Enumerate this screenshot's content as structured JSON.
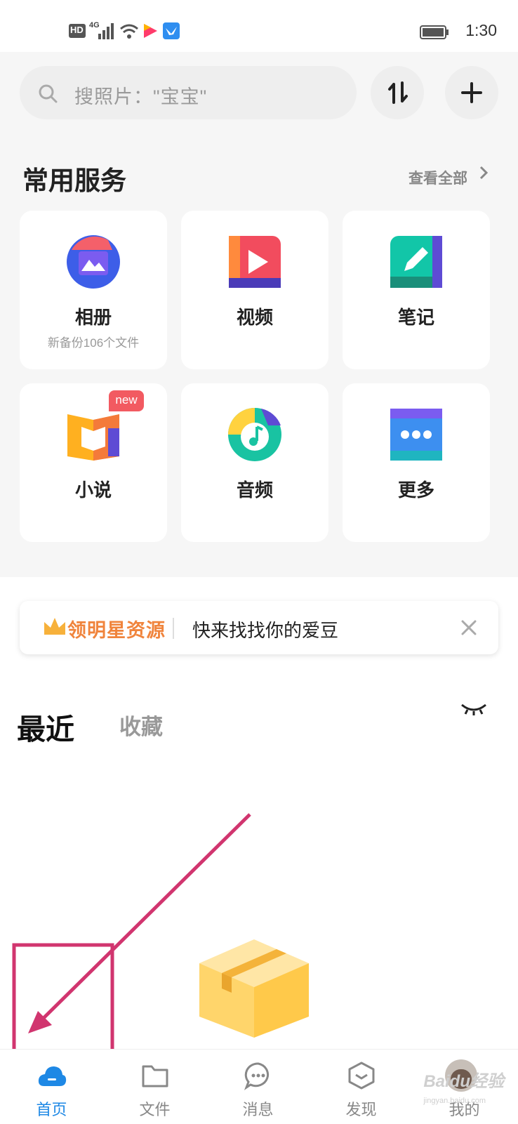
{
  "status_bar": {
    "network_label": "HD",
    "signal_label": "4G",
    "time": "1:30"
  },
  "search": {
    "placeholder": "搜照片：\"宝宝\""
  },
  "services": {
    "title": "常用服务",
    "view_all": "查看全部",
    "items": [
      {
        "label": "相册",
        "sub": "新备份106个文件",
        "icon": "album-icon"
      },
      {
        "label": "视频",
        "sub": "",
        "icon": "video-icon"
      },
      {
        "label": "笔记",
        "sub": "",
        "icon": "note-icon"
      },
      {
        "label": "小说",
        "sub": "",
        "icon": "novel-icon",
        "badge": "new"
      },
      {
        "label": "音频",
        "sub": "",
        "icon": "audio-icon"
      },
      {
        "label": "更多",
        "sub": "",
        "icon": "more-icon"
      }
    ]
  },
  "banner": {
    "brand": "领明星资源",
    "text": "快来找找你的爱豆"
  },
  "tabs": {
    "recent": "最近",
    "favorites": "收藏"
  },
  "bottom_nav": [
    {
      "label": "首页",
      "active": true
    },
    {
      "label": "文件",
      "active": false
    },
    {
      "label": "消息",
      "active": false
    },
    {
      "label": "发现",
      "active": false
    },
    {
      "label": "我的",
      "active": false
    }
  ],
  "watermark": {
    "main": "Baidu经验",
    "sub": "jingyan.baidu.com"
  },
  "colors": {
    "accent": "#1e88e5",
    "annotation": "#d1356f",
    "badge": "#f25a61"
  }
}
